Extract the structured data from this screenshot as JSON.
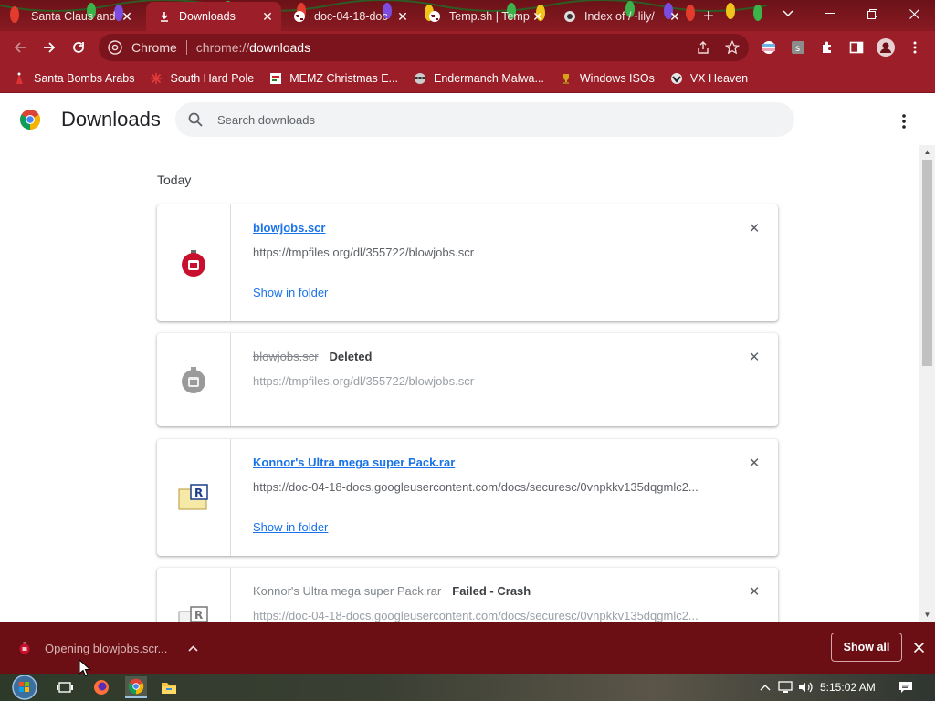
{
  "tabs": [
    {
      "title": "Santa Claus and",
      "active": false,
      "icon": "santa-favicon"
    },
    {
      "title": "Downloads",
      "active": true,
      "icon": "download-favicon"
    },
    {
      "title": "doc-04-18-doc",
      "active": false,
      "icon": "globe-favicon"
    },
    {
      "title": "Temp.sh | Temp",
      "active": false,
      "icon": "globe-favicon"
    },
    {
      "title": "Index of /~lily/",
      "active": false,
      "icon": "vx-favicon"
    }
  ],
  "omnibox": {
    "site": "Chrome",
    "url_prefix": "chrome://",
    "url_path": "downloads"
  },
  "bookmarks": [
    {
      "label": "Santa Bombs Arabs",
      "icon": "santa-icon"
    },
    {
      "label": "South Hard Pole",
      "icon": "snowflake-icon"
    },
    {
      "label": "MEMZ Christmas E...",
      "icon": "memz-icon"
    },
    {
      "label": "Endermanch Malwa...",
      "icon": "raccoon-icon"
    },
    {
      "label": "Windows ISOs",
      "icon": "trophy-icon"
    },
    {
      "label": "VX Heaven",
      "icon": "vx-icon"
    }
  ],
  "downloads_page": {
    "title": "Downloads",
    "search_placeholder": "Search downloads",
    "section_label": "Today",
    "items": [
      {
        "name": "blowjobs.scr",
        "url": "https://tmpfiles.org/dl/355722/blowjobs.scr",
        "status": "",
        "action": "Show in folder",
        "deleted": false,
        "icon": "ornament-icon"
      },
      {
        "name": "blowjobs.scr",
        "url": "https://tmpfiles.org/dl/355722/blowjobs.scr",
        "status": "Deleted",
        "action": "",
        "deleted": true,
        "icon": "ornament-grey-icon"
      },
      {
        "name": "Konnor's Ultra mega super Pack.rar",
        "url": "https://doc-04-18-docs.googleusercontent.com/docs/securesc/0vnpkkv135dqgmlc2...",
        "status": "",
        "action": "Show in folder",
        "deleted": false,
        "icon": "rar-icon"
      },
      {
        "name": "Konnor's Ultra mega super Pack.rar",
        "url": "https://doc-04-18-docs.googleusercontent.com/docs/securesc/0vnpkkv135dqgmlc2...",
        "status": "Failed - Crash",
        "action": "",
        "deleted": true,
        "icon": "rar-grey-icon"
      }
    ]
  },
  "shelf": {
    "item_text": "Opening blowjobs.scr...",
    "show_all": "Show all"
  },
  "taskbar": {
    "clock": "5:15:02 AM"
  },
  "colors": {
    "accent": "#1a73e8",
    "frame": "#9b1e28",
    "shelf": "#6b0f15"
  }
}
